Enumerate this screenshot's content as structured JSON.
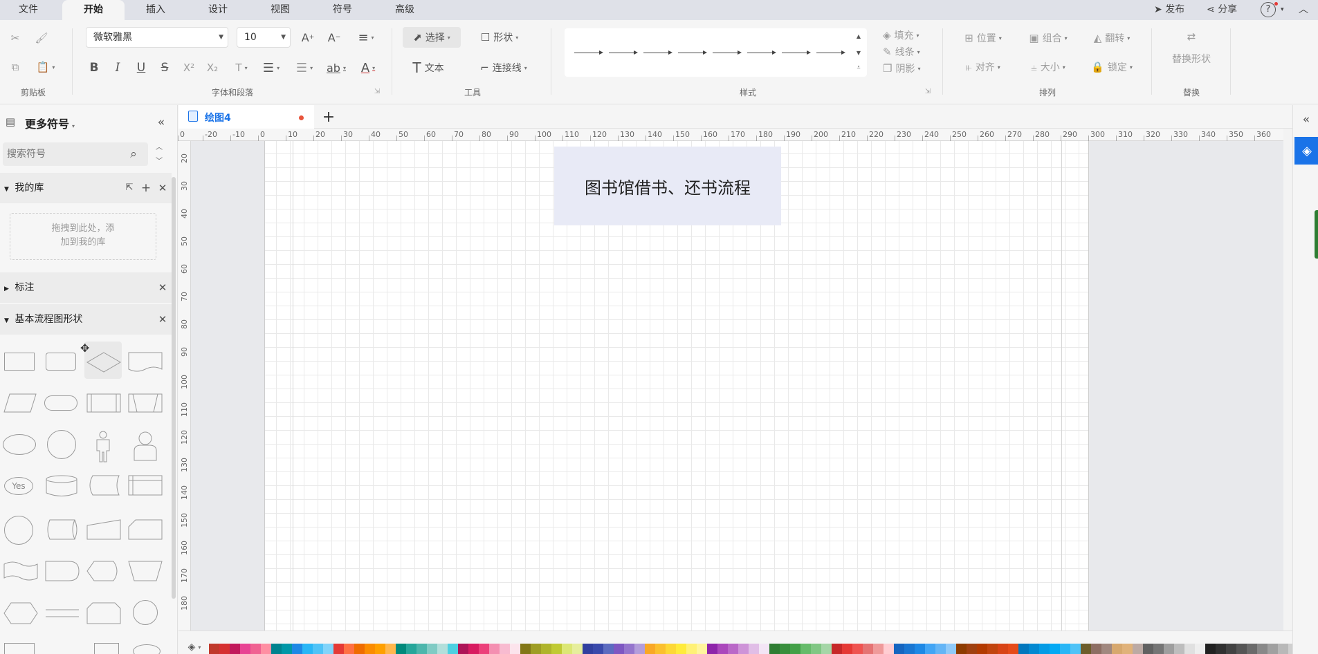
{
  "menubar": {
    "tabs": [
      "文件",
      "开始",
      "插入",
      "设计",
      "视图",
      "符号",
      "高级"
    ],
    "active_tab": "开始",
    "publish": "发布",
    "share": "分享",
    "help": "?"
  },
  "ribbon": {
    "clipboard": {
      "label": "剪贴板"
    },
    "font": {
      "family": "微软雅黑",
      "size": "10",
      "label": "字体和段落"
    },
    "tools": {
      "select": "选择",
      "shape": "形状",
      "text": "文本",
      "connector": "连接线",
      "label": "工具"
    },
    "style": {
      "label": "样式",
      "fill": "填充",
      "line": "线条",
      "shadow": "阴影"
    },
    "arrange": {
      "position": "位置",
      "group": "组合",
      "flip": "翻转",
      "align": "对齐",
      "size": "大小",
      "lock": "锁定",
      "label": "排列"
    },
    "replace": {
      "button": "替换形状",
      "label": "替换"
    }
  },
  "sidebar": {
    "title": "更多符号",
    "search_placeholder": "搜索符号",
    "my_library": {
      "title": "我的库",
      "drop_hint_1": "拖拽到此处，添",
      "drop_hint_2": "加到我的库"
    },
    "annotation": {
      "title": "标注"
    },
    "basic_flow": {
      "title": "基本流程图形状",
      "yes_label": "Yes"
    }
  },
  "document": {
    "tab_name": "绘图4",
    "unsaved": true
  },
  "ruler": {
    "h_ticks": [
      "0",
      "-20",
      "-10",
      "0",
      "10",
      "20",
      "30",
      "40",
      "50",
      "60",
      "70",
      "80",
      "90",
      "100",
      "110",
      "120",
      "130",
      "140",
      "150",
      "160",
      "170",
      "180",
      "190",
      "200",
      "210",
      "220",
      "230",
      "240",
      "250",
      "260",
      "270",
      "280",
      "290",
      "300",
      "310",
      "320",
      "330",
      "340",
      "350",
      "360"
    ],
    "v_ticks": [
      "20",
      "30",
      "40",
      "50",
      "60",
      "70",
      "80",
      "90",
      "100",
      "110",
      "120",
      "130",
      "140",
      "150",
      "160",
      "170",
      "180"
    ]
  },
  "canvas": {
    "title_text": "图书馆借书、还书流程",
    "title_fill": "#e8eaf6"
  },
  "palette": {
    "colors": [
      "#c0392b",
      "#d63031",
      "#c2185b",
      "#e84393",
      "#f06292",
      "#ff8fa3",
      "#00838f",
      "#0097a7",
      "#1e88e5",
      "#29b6f6",
      "#4fc3f7",
      "#81d4fa",
      "#e53935",
      "#ff7043",
      "#ef6c00",
      "#fb8c00",
      "#ffa000",
      "#ffb74d",
      "#00897b",
      "#26a69a",
      "#4db6ac",
      "#80cbc4",
      "#b2dfdb",
      "#4dd0e1",
      "#ad1457",
      "#d81b60",
      "#ec407a",
      "#f48fb1",
      "#f8bbd0",
      "#fce4ec",
      "#827717",
      "#9e9d24",
      "#afb42b",
      "#c0ca33",
      "#dce775",
      "#e6ee9c",
      "#303f9f",
      "#3949ab",
      "#5c6bc0",
      "#7e57c2",
      "#9575cd",
      "#b39ddb",
      "#f9a825",
      "#fbc02d",
      "#fdd835",
      "#ffeb3b",
      "#fff176",
      "#fff59d",
      "#8e24aa",
      "#ab47bc",
      "#ba68c8",
      "#ce93d8",
      "#e1bee7",
      "#f3e5f5",
      "#2e7d32",
      "#388e3c",
      "#43a047",
      "#66bb6a",
      "#81c784",
      "#a5d6a7",
      "#c62828",
      "#e53935",
      "#ef5350",
      "#e57373",
      "#ef9a9a",
      "#ffcdd2",
      "#1565c0",
      "#1976d2",
      "#1e88e5",
      "#42a5f5",
      "#64b5f6",
      "#90caf9",
      "#8d3b00",
      "#a0400f",
      "#b23a00",
      "#c1440e",
      "#d84315",
      "#e64a19",
      "#0277bd",
      "#0288d1",
      "#039be5",
      "#03a9f4",
      "#29b6f6",
      "#4fc3f7",
      "#6d5d2a",
      "#8d6e63",
      "#a1887f",
      "#d7a86e",
      "#e0b27a",
      "#bcaaa4",
      "#616161",
      "#757575",
      "#9e9e9e",
      "#bdbdbd",
      "#e0e0e0",
      "#eeeeee",
      "#212121",
      "#303030",
      "#424242",
      "#555555",
      "#6a6a6a",
      "#888888",
      "#a0a0a0",
      "#b8b8b8",
      "#cfcfcf",
      "#e6e6e6",
      "#f2f2f2"
    ]
  }
}
